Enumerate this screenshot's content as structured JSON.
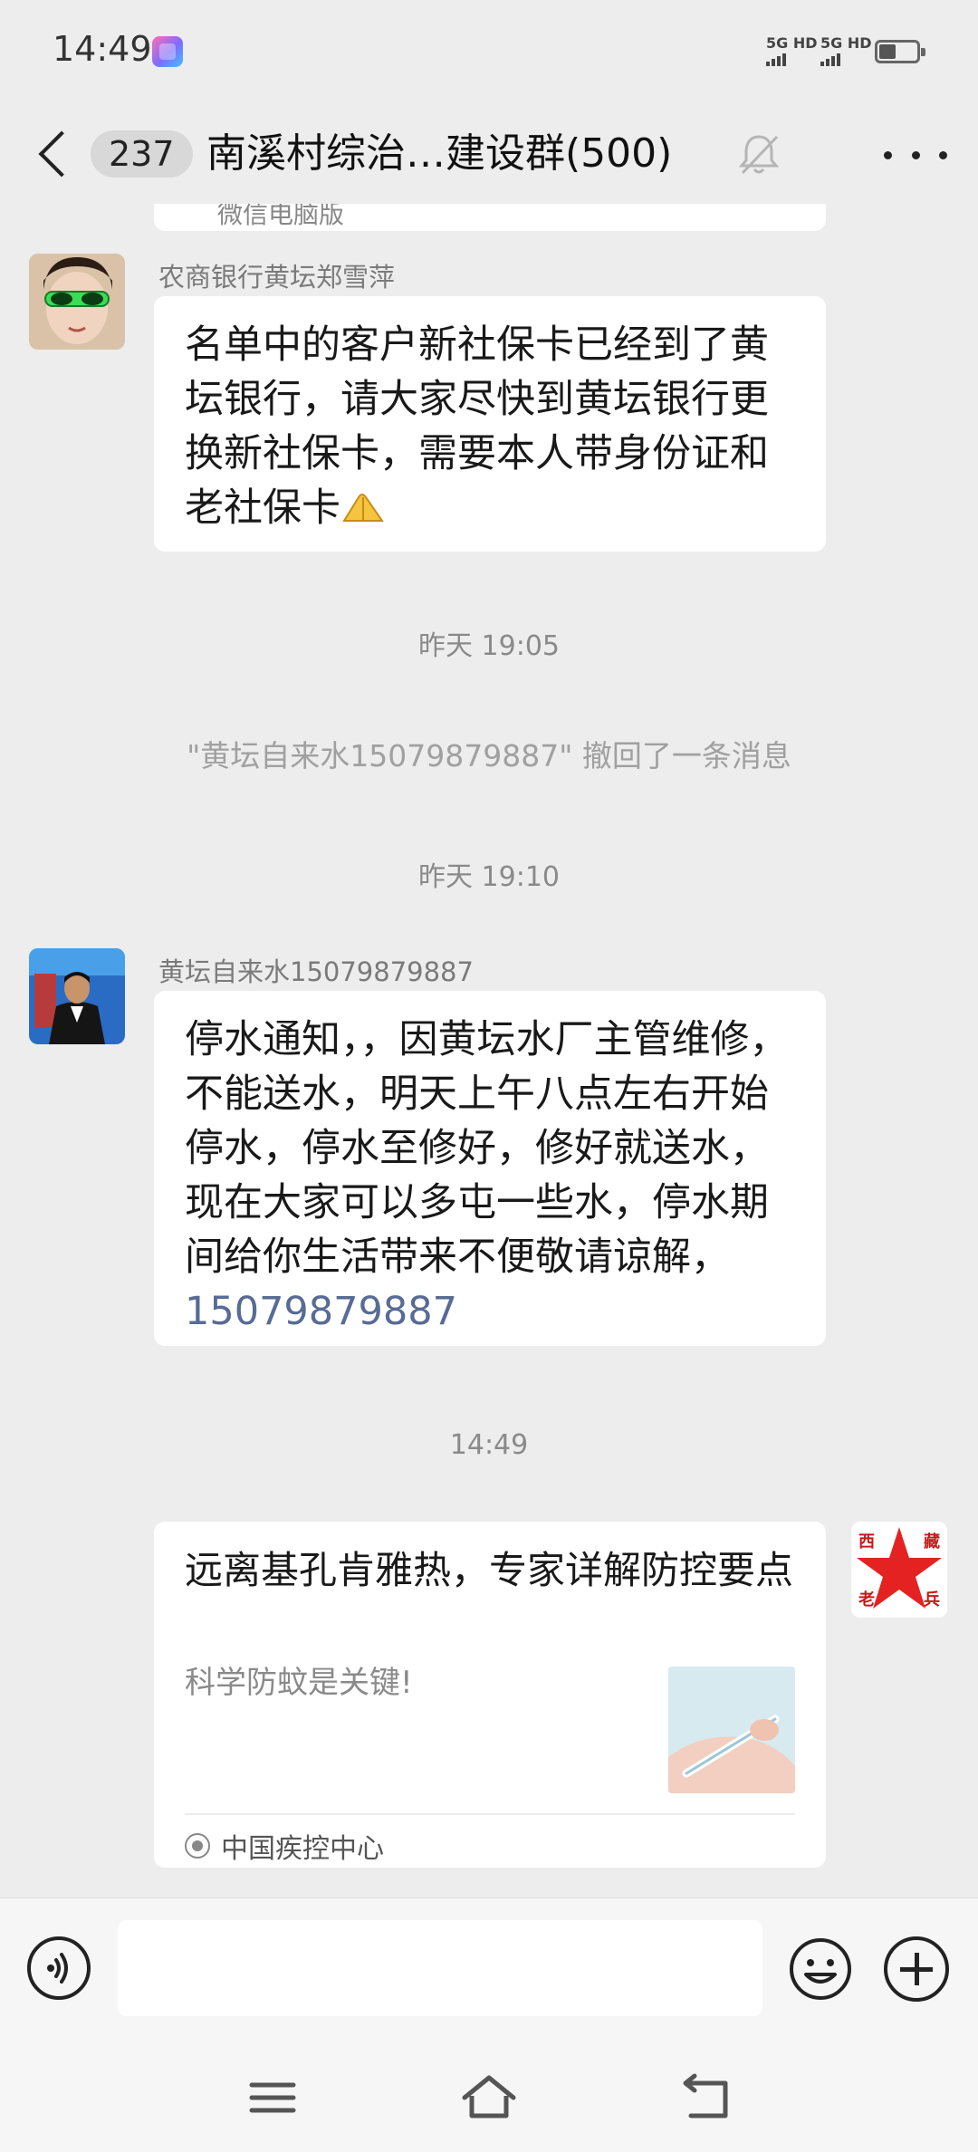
{
  "status_bar": {
    "time": "14:49",
    "signal1": "5G HD",
    "signal2": "5G HD"
  },
  "header": {
    "unread_count": "237",
    "title": "南溪村综治…建设群(500)"
  },
  "messages": {
    "partial_top_text": "微信电脑版",
    "msg1": {
      "sender": "农商银行黄坛郑雪萍",
      "text": "名单中的客户新社保卡已经到了黄坛银行，请大家尽快到黄坛银行更换新社保卡，需要本人带身份证和老社保卡",
      "emoji": "praying-hands-emoji"
    },
    "timestamp1": "昨天 19:05",
    "system_recall": "\"黄坛自来水15079879887\" 撤回了一条消息",
    "timestamp2": "昨天 19:10",
    "msg2": {
      "sender": "黄坛自来水15079879887",
      "text": "停水通知，，因黄坛水厂主管维修，不能送水，明天上午八点左右开始停水，停水至修好，修好就送水，现在大家可以多屯一些水，停水期间给你生活带来不便敬请谅解，",
      "phone": "15079879887"
    },
    "timestamp3": "14:49",
    "shared_card": {
      "title": "远离基孔肯雅热，专家详解防控要点",
      "description": "科学防蚊是关键!",
      "source": "中国疾控中心"
    },
    "own_avatar_chars": [
      "西",
      "藏",
      "老",
      "兵"
    ]
  },
  "colors": {
    "background": "#ededed",
    "bubble": "#ffffff",
    "link": "#576b95",
    "avatar_star": "#e52222"
  },
  "input_bar": {
    "placeholder": ""
  }
}
